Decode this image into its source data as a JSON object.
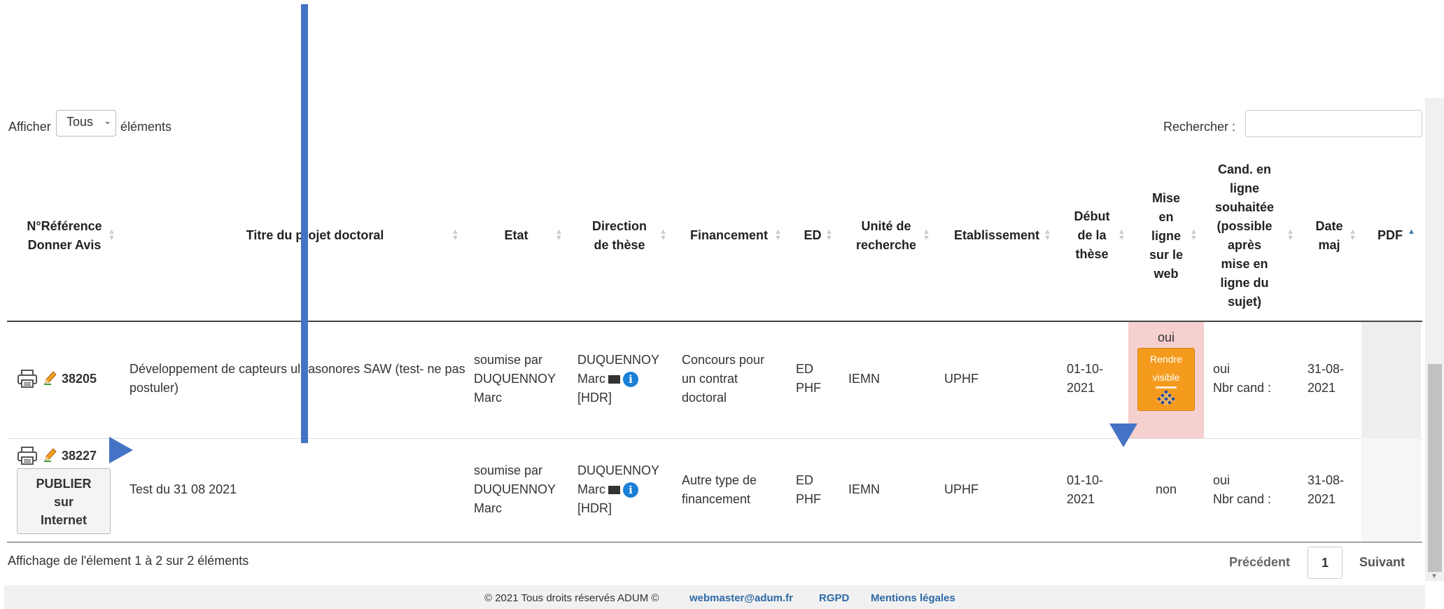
{
  "length_control": {
    "show_label": "Afficher",
    "selected": "Tous",
    "suffix": "éléments"
  },
  "search": {
    "label": "Rechercher :",
    "value": ""
  },
  "table": {
    "headers": [
      "N°Référence\nDonner Avis",
      "Titre du projet doctoral",
      "Etat",
      "Direction\nde thèse",
      "Financement",
      "ED",
      "Unité de\nrecherche",
      "Etablissement",
      "Début\nde la\nthèse",
      "Mise\nen\nligne\nsur le\nweb",
      "Cand. en\nligne\nsouhaitée\n(possible\naprès\nmise en\nligne du\nsujet)",
      "Date\nmaj",
      "PDF"
    ],
    "rows": [
      {
        "ref": "38205",
        "title": "Développement de capteurs ultrasonores SAW (test- ne pas postuler)",
        "etat": "soumise par DUQUENNOY Marc",
        "direction_name": "DUQUENNOY Marc",
        "direction_hdr": "[HDR]",
        "financement": "Concours pour un contrat doctoral",
        "ed": "ED PHF",
        "unite": "IEMN",
        "etablissement": "UPHF",
        "debut": "01-10-2021",
        "mise_en_ligne": "oui",
        "mise_button": "Rendre visible",
        "cand_en_ligne": "oui",
        "nbr_cand": "Nbr cand :",
        "date_maj": "31-08-2021"
      },
      {
        "ref": "38227",
        "publish_button": "PUBLIER sur Internet",
        "title": "Test du 31 08 2021",
        "etat": "soumise par DUQUENNOY Marc",
        "direction_name": "DUQUENNOY Marc",
        "direction_hdr": "[HDR]",
        "financement": "Autre type de financement",
        "ed": "ED PHF",
        "unite": "IEMN",
        "etablissement": "UPHF",
        "debut": "01-10-2021",
        "mise_en_ligne": "non",
        "cand_en_ligne": "oui",
        "nbr_cand": "Nbr cand :",
        "date_maj": "31-08-2021"
      }
    ]
  },
  "info": "Affichage de l'élement 1 à 2 sur 2 éléments",
  "pagination": {
    "previous": "Précédent",
    "page": "1",
    "next": "Suivant"
  },
  "footer": {
    "copyright": "© 2021 Tous droits réservés ADUM ©",
    "email": "webmaster@adum.fr",
    "rgpd": "RGPD",
    "legal": "Mentions légales"
  },
  "colors": {
    "annotation": "#4472c4",
    "highlight_cell": "#f6cfcf",
    "rendre_button": "#f49b1e",
    "link": "#2d6aa7"
  }
}
